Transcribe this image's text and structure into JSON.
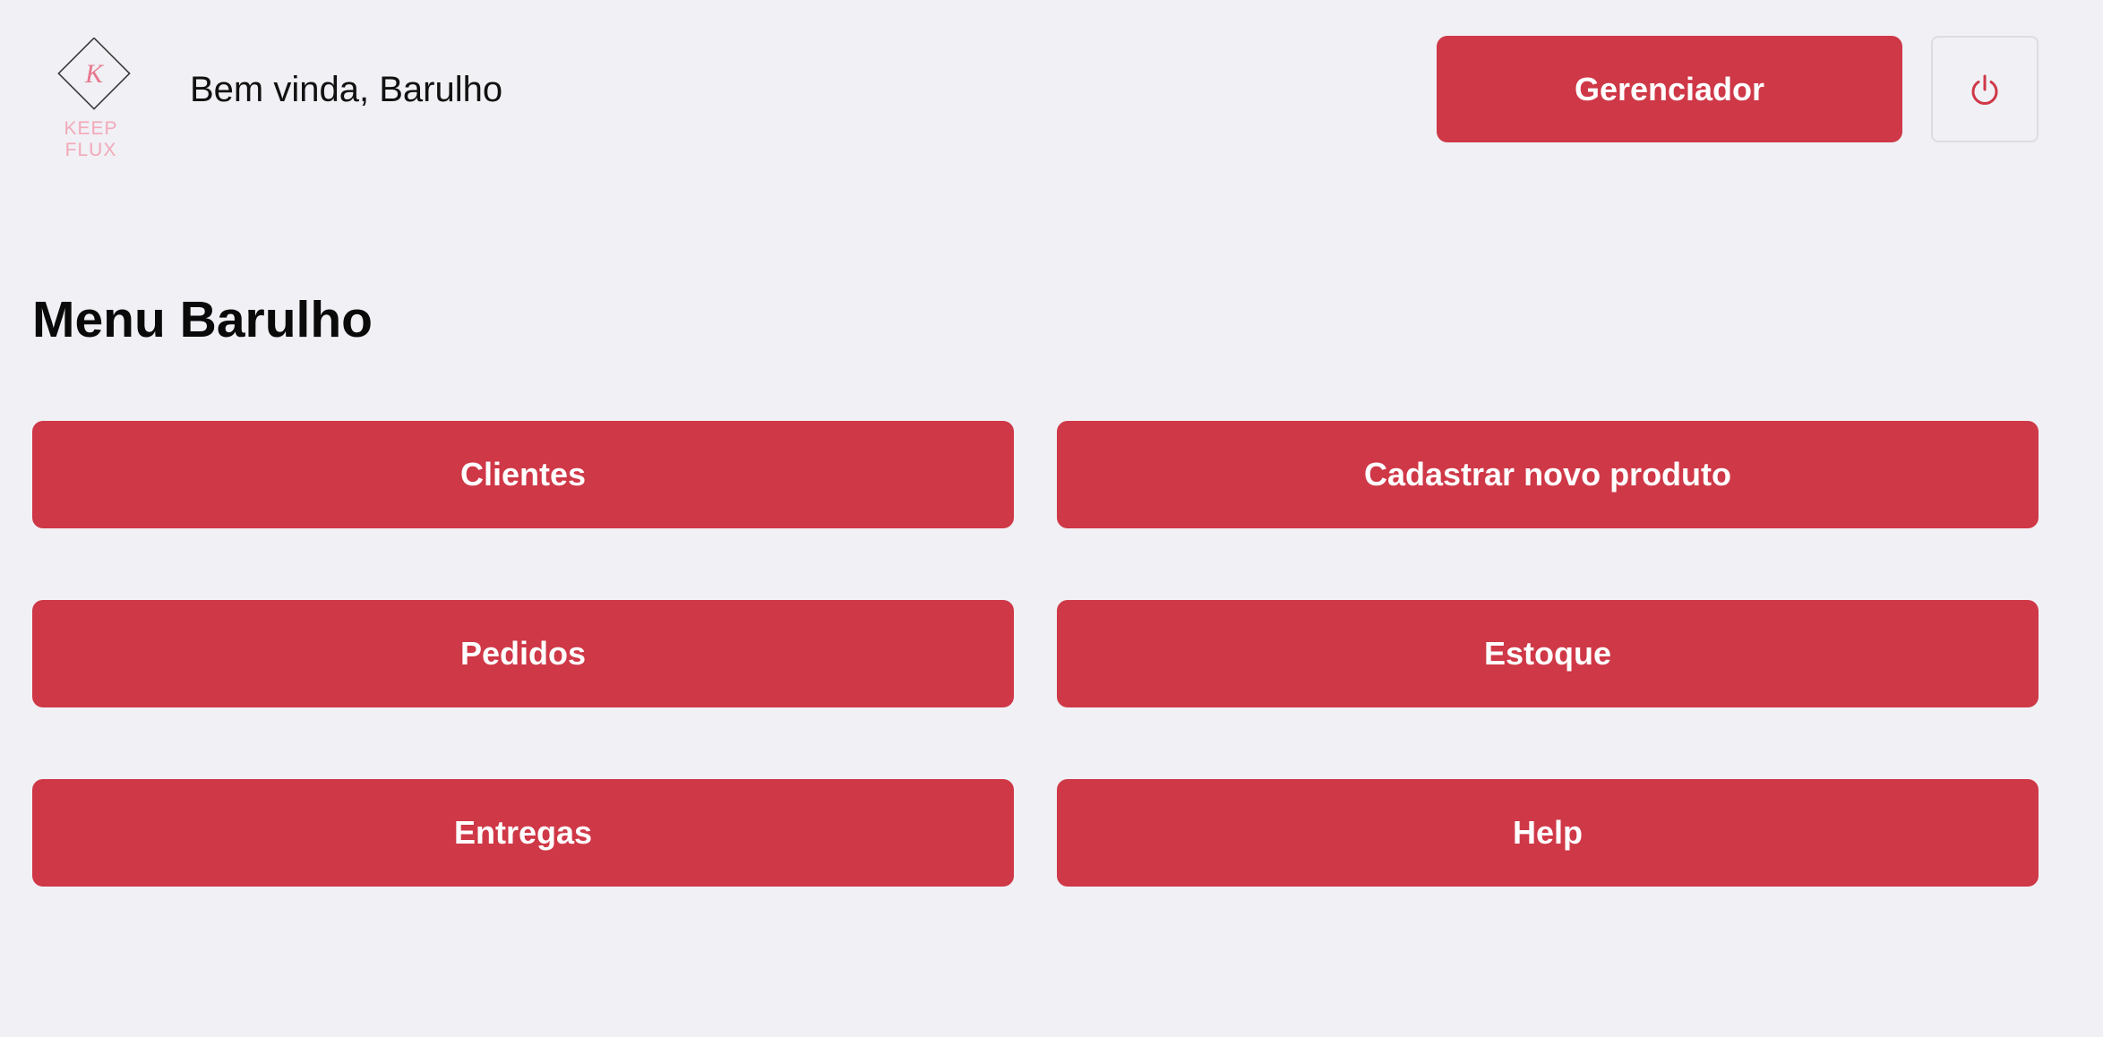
{
  "header": {
    "logo": {
      "text": "KEEP FLUX",
      "monogram": "K",
      "icon": "keep-flux-logo"
    },
    "greeting": "Bem vinda, Barulho",
    "manager_label": "Gerenciador",
    "power_icon": "power-icon"
  },
  "main": {
    "title": "Menu Barulho",
    "buttons": [
      {
        "label": "Clientes"
      },
      {
        "label": "Cadastrar novo produto"
      },
      {
        "label": "Pedidos"
      },
      {
        "label": "Estoque"
      },
      {
        "label": "Entregas"
      },
      {
        "label": "Help"
      }
    ]
  },
  "colors": {
    "background": "#f0f0f5",
    "accent": "#cf3847",
    "logo_pink": "#f2a9b8",
    "text": "#0a0a0a"
  }
}
